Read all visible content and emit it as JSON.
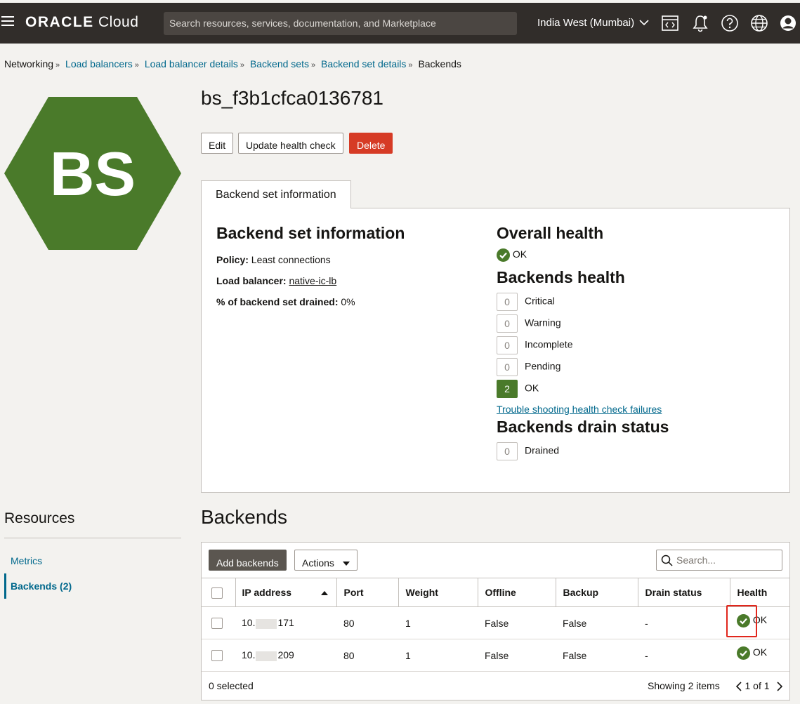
{
  "topbar": {
    "brand_main": "ORACLE",
    "brand_sub": " Cloud",
    "search_placeholder": "Search resources, services, documentation, and Marketplace",
    "region": "India West (Mumbai)"
  },
  "breadcrumb": [
    "Networking",
    "Load balancers",
    "Load balancer details",
    "Backend sets",
    "Backend set details",
    "Backends"
  ],
  "icon_text": "BS",
  "title": "bs_f3b1cfca0136781",
  "actions": {
    "edit": "Edit",
    "update": "Update health check",
    "delete": "Delete"
  },
  "tab_label": "Backend set information",
  "info": {
    "heading": "Backend set information",
    "policy_label": "Policy:",
    "policy_value": "Least connections",
    "lb_label": "Load balancer:",
    "lb_value": "native-ic-lb",
    "drained_label": "% of backend set drained:",
    "drained_value": "0%"
  },
  "health": {
    "overall_heading": "Overall health",
    "overall_value": "OK",
    "backends_heading": "Backends health",
    "rows": [
      {
        "count": "0",
        "label": "Critical"
      },
      {
        "count": "0",
        "label": "Warning"
      },
      {
        "count": "0",
        "label": "Incomplete"
      },
      {
        "count": "0",
        "label": "Pending"
      },
      {
        "count": "2",
        "label": "OK"
      }
    ],
    "trouble_link": "Trouble shooting health check failures",
    "drain_heading": "Backends drain status",
    "drain_count": "0",
    "drain_label": "Drained"
  },
  "resources": {
    "title": "Resources",
    "items": [
      "Metrics",
      "Backends (2)"
    ]
  },
  "backends": {
    "title": "Backends",
    "add_button": "Add backends",
    "actions_button": "Actions",
    "search_placeholder": "Search...",
    "columns": [
      "IP address",
      "Port",
      "Weight",
      "Offline",
      "Backup",
      "Drain status",
      "Health"
    ],
    "rows": [
      {
        "ip_prefix": "10.",
        "ip_suffix": "171",
        "port": "80",
        "weight": "1",
        "offline": "False",
        "backup": "False",
        "drain": "-",
        "health": "OK"
      },
      {
        "ip_prefix": "10.",
        "ip_suffix": "209",
        "port": "80",
        "weight": "1",
        "offline": "False",
        "backup": "False",
        "drain": "-",
        "health": "OK"
      }
    ],
    "selected": "0 selected",
    "showing": "Showing 2 items",
    "page": "1 of 1"
  },
  "colors": {
    "header": "#312d2a",
    "hexagon": "#4a7a2a",
    "danger": "#d63b25",
    "link": "#00688c",
    "ok": "#4a7a2a",
    "highlight": "#e1261c"
  }
}
